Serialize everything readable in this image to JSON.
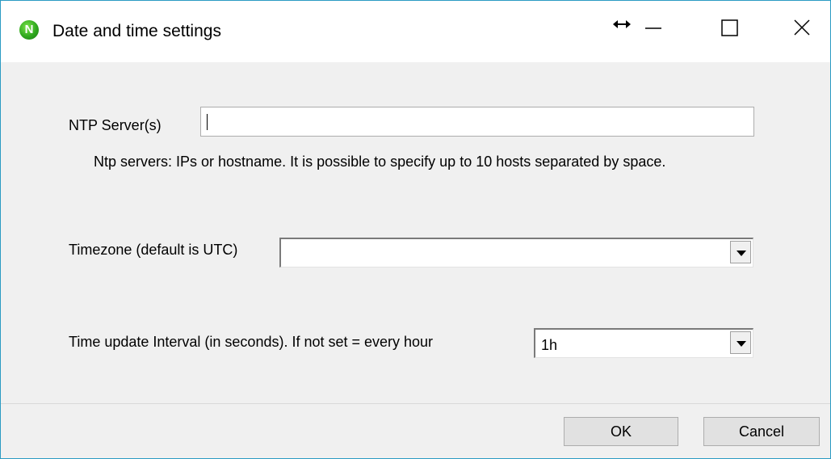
{
  "window": {
    "title": "Date and time settings",
    "app_icon_glyph": "N",
    "app_icon_color": "#2fa81e",
    "border_color": "#2b9bc3",
    "controls": [
      "resize-horizontal-icon",
      "minimize-icon",
      "maximize-icon",
      "close-icon"
    ]
  },
  "form": {
    "ntp": {
      "label": "NTP Server(s)",
      "value": "",
      "help": "Ntp servers: IPs or hostname. It is possible to specify up to 10 hosts separated by space."
    },
    "timezone": {
      "label": "Timezone (default is UTC)",
      "value": ""
    },
    "interval": {
      "label": "Time update Interval (in seconds). If not set = every hour",
      "value": "1h"
    }
  },
  "buttons": {
    "ok": "OK",
    "cancel": "Cancel"
  }
}
